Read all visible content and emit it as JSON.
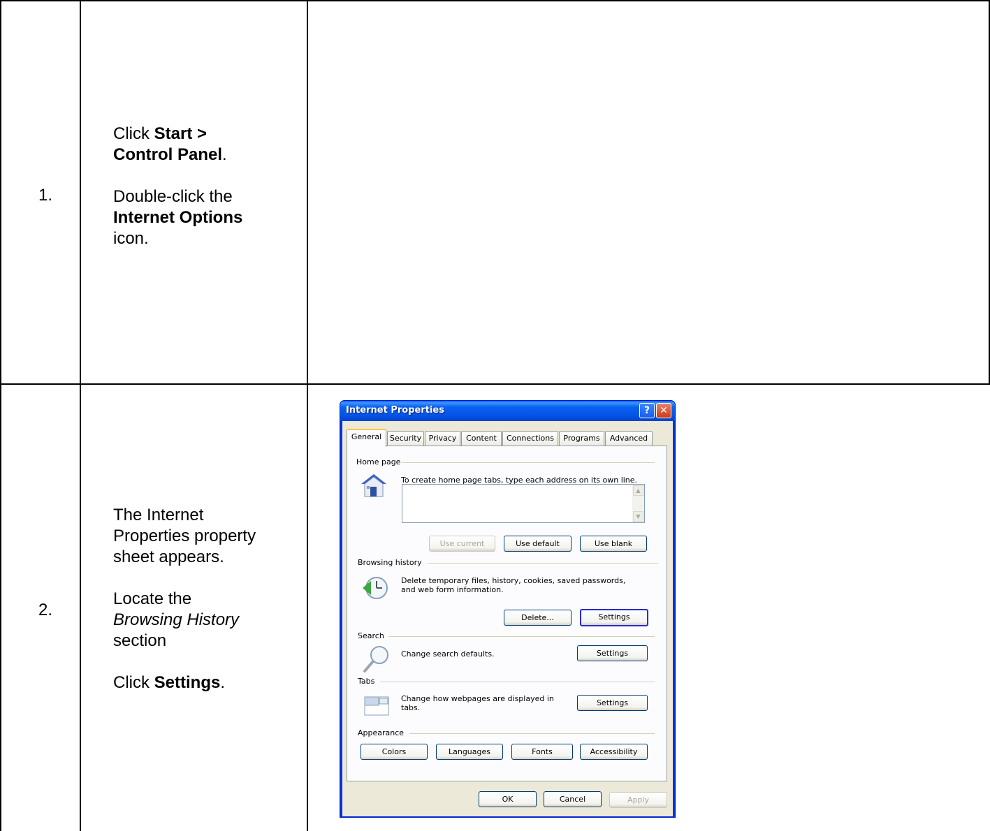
{
  "steps": [
    {
      "number": "1.",
      "line1_prefix": "Click ",
      "line1_bold_a": "Start >",
      "line1_bold_b": "Control Panel",
      "line1_suffix": ".",
      "line2_prefix": "Double-click the",
      "line2_bold": "Internet Options",
      "line2_suffix": "icon."
    },
    {
      "number": "2.",
      "para1": [
        "The Internet",
        "Properties property",
        "sheet appears."
      ],
      "para2_prefix": "Locate the",
      "para2_italic": "Browsing History",
      "para2_suffix": "section",
      "para3_prefix": "Click ",
      "para3_bold": "Settings",
      "para3_suffix": "."
    }
  ],
  "dialog": {
    "title": "Internet Properties",
    "help_label": "?",
    "close_label": "✕",
    "tabs": [
      "General",
      "Security",
      "Privacy",
      "Content",
      "Connections",
      "Programs",
      "Advanced"
    ],
    "active_tab": "General",
    "home_page": {
      "label": "Home page",
      "description": "To create home page tabs, type each address on its own line.",
      "value": "",
      "buttons": [
        "Use current",
        "Use default",
        "Use blank"
      ]
    },
    "browsing_history": {
      "label": "Browsing history",
      "description_line1": "Delete temporary files, history, cookies, saved passwords,",
      "description_line2": "and web form information.",
      "delete_button": "Delete...",
      "settings_button": "Settings"
    },
    "search": {
      "label": "Search",
      "description": "Change search defaults.",
      "settings_button": "Settings"
    },
    "tabs_section": {
      "label": "Tabs",
      "description_line1": "Change how webpages are displayed in",
      "description_line2": "tabs.",
      "settings_button": "Settings"
    },
    "appearance": {
      "label": "Appearance",
      "buttons": [
        "Colors",
        "Languages",
        "Fonts",
        "Accessibility"
      ]
    },
    "footer_buttons": [
      "OK",
      "Cancel",
      "Apply"
    ]
  },
  "colors": {
    "xp_title_blue": "#0a5fe8",
    "xp_dialog_face": "#ece9d8",
    "focus_border": "#2a2ad0"
  }
}
